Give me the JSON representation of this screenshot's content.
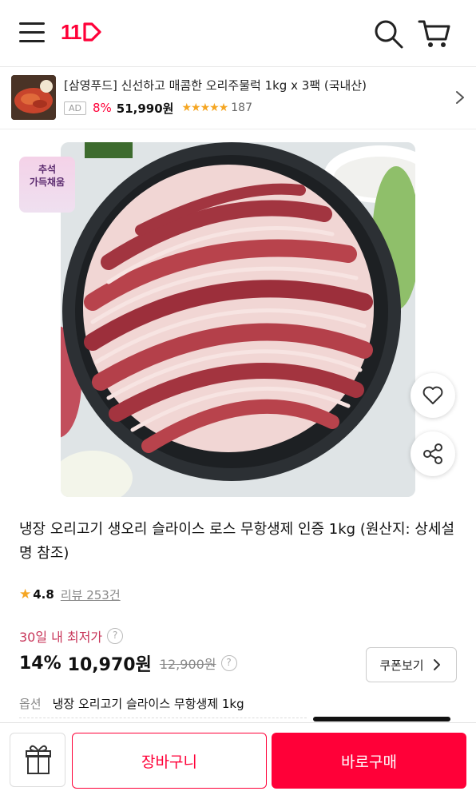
{
  "header": {
    "logo_text": "11",
    "icons": [
      "menu-icon",
      "search-icon",
      "cart-icon"
    ]
  },
  "ad": {
    "title": "[삼영푸드] 신선하고 매콤한 오리주물럭 1kg x 3팩 (국내산)",
    "badge": "AD",
    "discount": "8%",
    "price": "51,990원",
    "stars": "★★★★★",
    "rating": 4.5,
    "review_count": "187"
  },
  "promo_badge": {
    "line1": "추석",
    "line2": "가득채움"
  },
  "product": {
    "title": "냉장 오리고기 생오리 슬라이스 로스 무항생제 인증 1kg (원산지: 상세설명 참조)",
    "rating": "4.8",
    "review_text": "리뷰 253건",
    "lowest_label": "30일 내 최저가",
    "discount": "14%",
    "sale_price": "10,970원",
    "original_price": "12,900원",
    "coupon_label": "쿠폰보기",
    "option_label": "옵션",
    "option_value": "냉장 오리고기 슬라이스 무항생제 1kg"
  },
  "bottom_bar": {
    "cart_label": "장바구니",
    "buy_label": "바로구매"
  },
  "colors": {
    "brand": "#ff0038",
    "star": "#f5a623",
    "lowest_label": "#c8365a"
  }
}
